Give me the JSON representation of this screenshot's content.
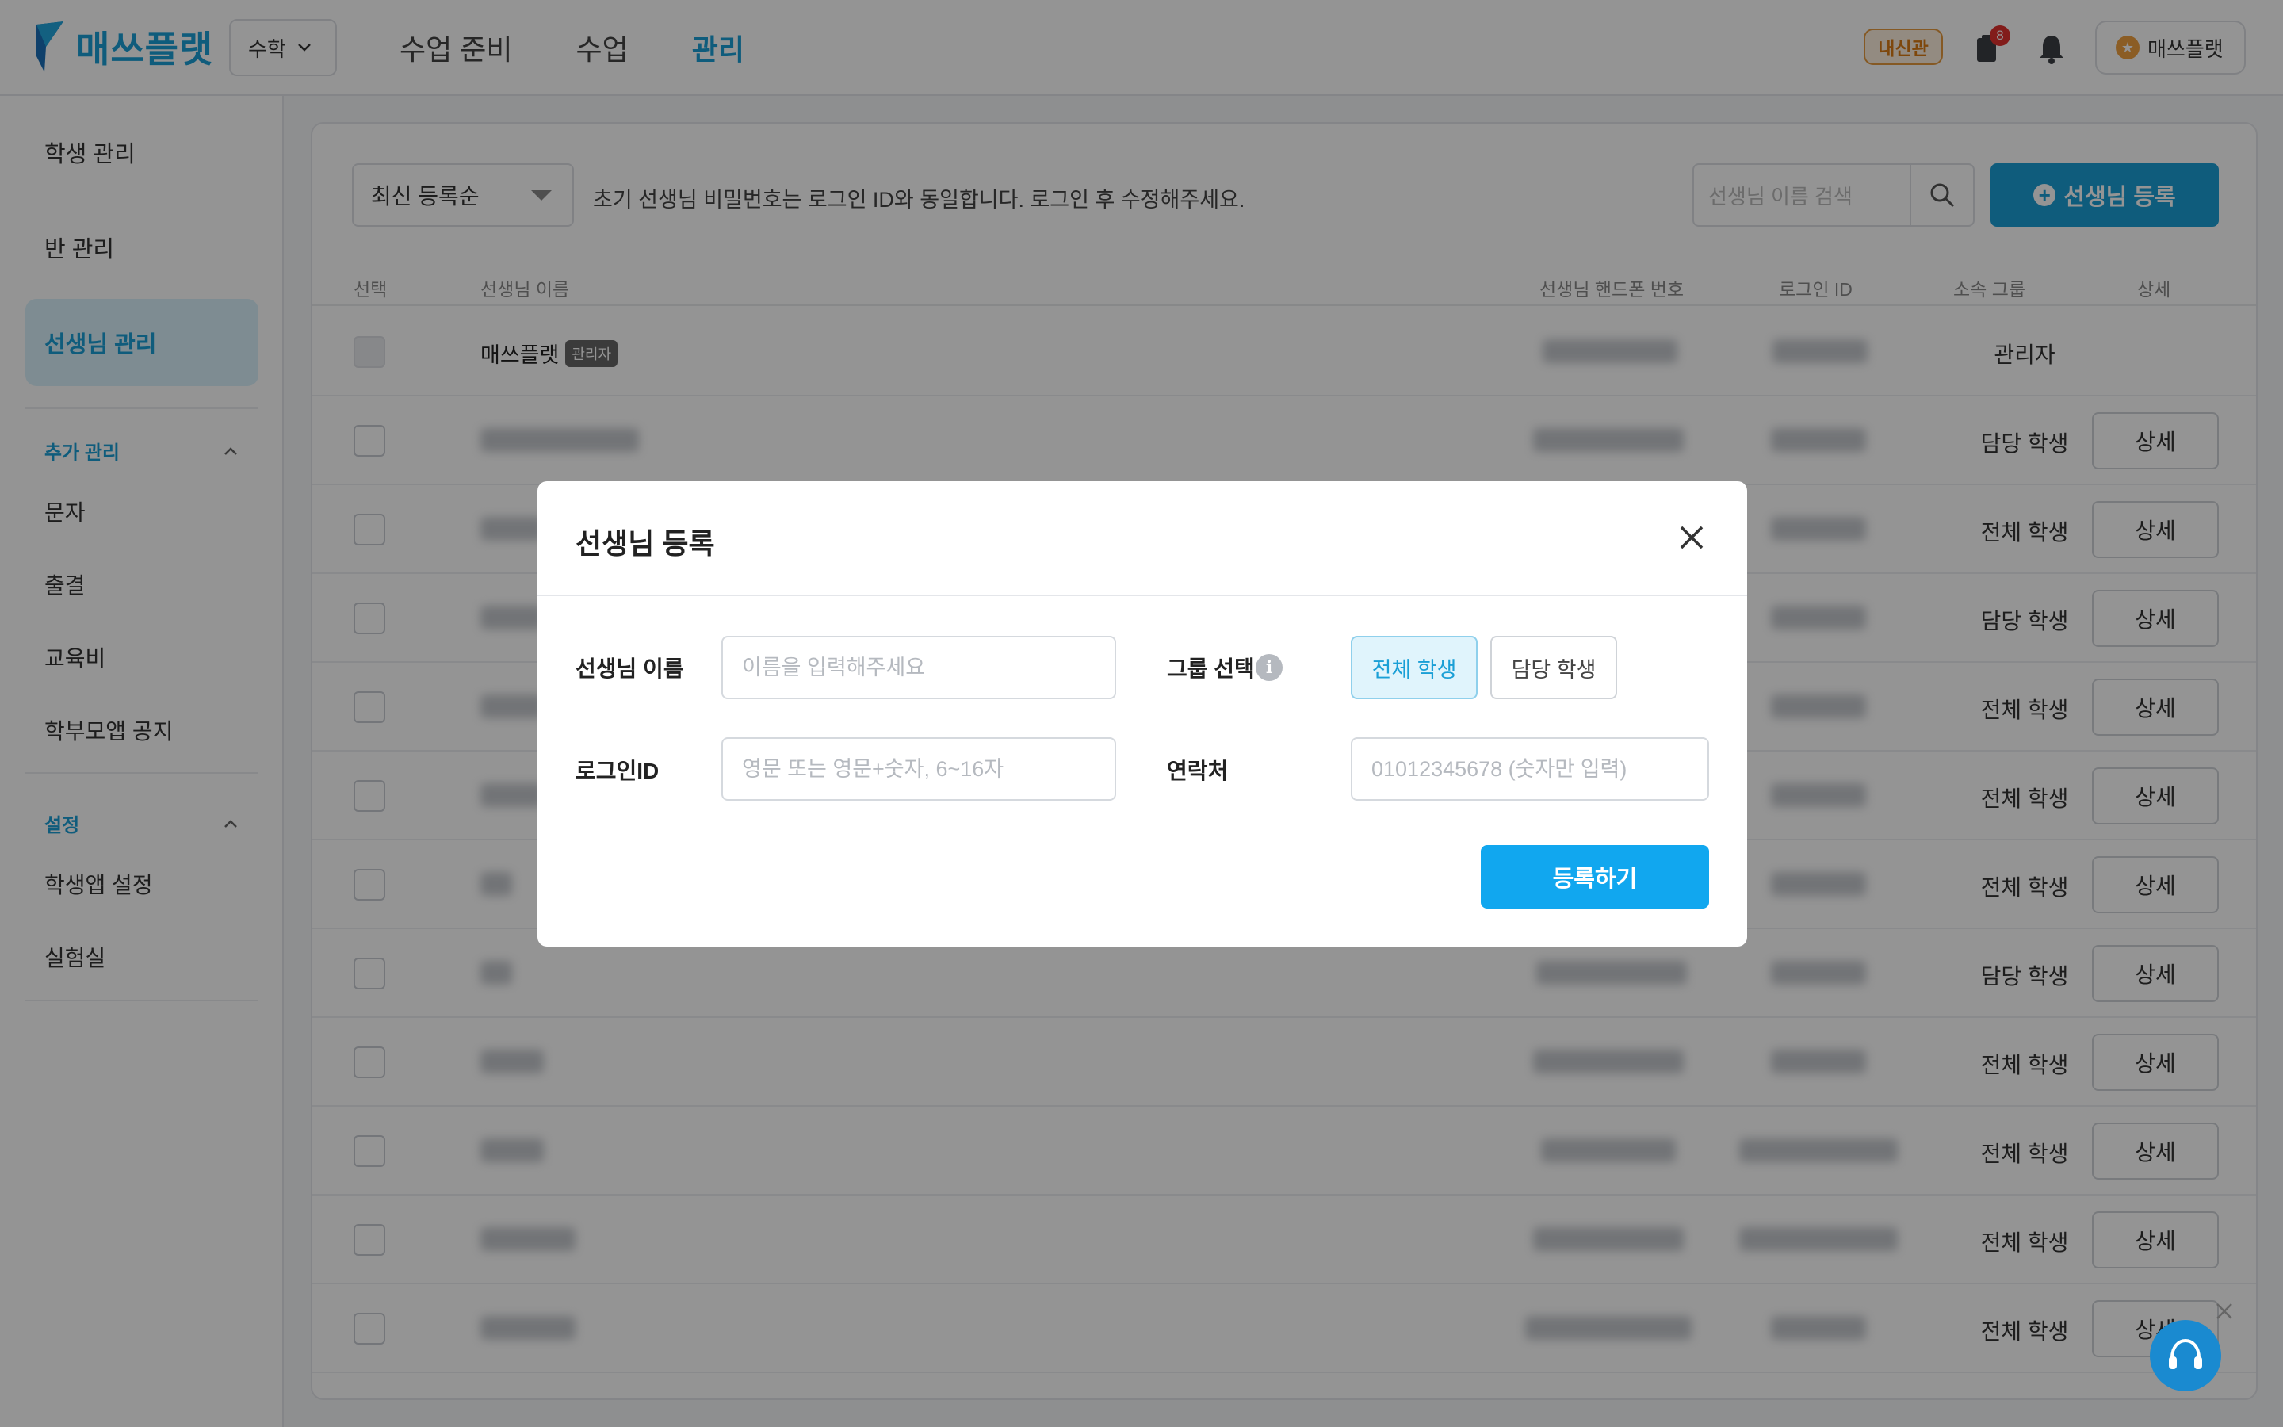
{
  "header": {
    "logo_text": "매쓰플랫",
    "subject": "수학",
    "nav": [
      "수업 준비",
      "수업",
      "관리"
    ],
    "active_nav": "관리",
    "gold_badge": "내신관",
    "notification_count": "8",
    "user_name": "매쓰플랫",
    "brand_color": "#1a9fd6"
  },
  "sidebar": {
    "items": [
      "학생 관리",
      "반 관리",
      "선생님 관리"
    ],
    "active_item": "선생님 관리",
    "extra_section": "추가 관리",
    "extra_items": [
      "문자",
      "출결",
      "교육비",
      "학부모앱 공지"
    ],
    "settings_section": "설정",
    "settings_items": [
      "학생앱 설정",
      "실험실"
    ]
  },
  "toolbar": {
    "sort": "최신 등록순",
    "notice": "초기 선생님 비밀번호는 로그인 ID와 동일합니다. 로그인 후 수정해주세요.",
    "search_placeholder": "선생님 이름 검색",
    "register_label": "선생님 등록"
  },
  "table": {
    "headers": [
      "선택",
      "선생님 이름",
      "선생님 핸드폰 번호",
      "로그인 ID",
      "소속 그룹",
      "상세"
    ],
    "admin_name": "매쓰플랫",
    "admin_tag": "관리자",
    "admin_group": "관리자",
    "detail_label": "상세",
    "groups": [
      "담당 학생",
      "전체 학생",
      "담당 학생",
      "전체 학생",
      "전체 학생",
      "전체 학생",
      "담당 학생",
      "전체 학생",
      "전체 학생",
      "전체 학생",
      "전체 학생"
    ]
  },
  "modal": {
    "title": "선생님 등록",
    "name_label": "선생님 이름",
    "name_placeholder": "이름을 입력해주세요",
    "group_label": "그룹 선택",
    "group_options": [
      "전체 학생",
      "담당 학생"
    ],
    "selected_group": "전체 학생",
    "login_label": "로그인ID",
    "login_placeholder": "영문 또는 영문+숫자, 6~16자",
    "contact_label": "연락처",
    "contact_placeholder": "01012345678 (숫자만 입력)",
    "submit_label": "등록하기"
  }
}
